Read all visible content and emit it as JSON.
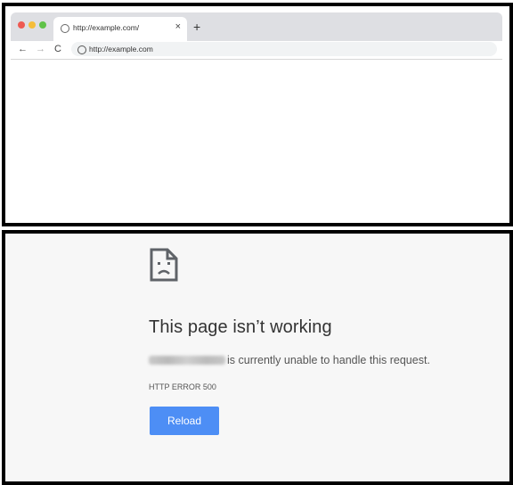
{
  "browser": {
    "tab": {
      "title": "http://example.com/",
      "close_glyph": "×",
      "icon": "globe-icon"
    },
    "new_tab_glyph": "+",
    "nav": {
      "back_glyph": "←",
      "forward_glyph": "→",
      "reload_glyph": "C"
    },
    "address": {
      "url": "http://example.com",
      "icon": "info-icon"
    }
  },
  "error_page": {
    "icon": "sad-page-icon",
    "title": "This page isn’t working",
    "message": "is currently unable to handle this request.",
    "code": "HTTP ERROR 500",
    "reload_label": "Reload",
    "colors": {
      "button": "#4d8ef5",
      "background": "#f7f7f7"
    }
  }
}
